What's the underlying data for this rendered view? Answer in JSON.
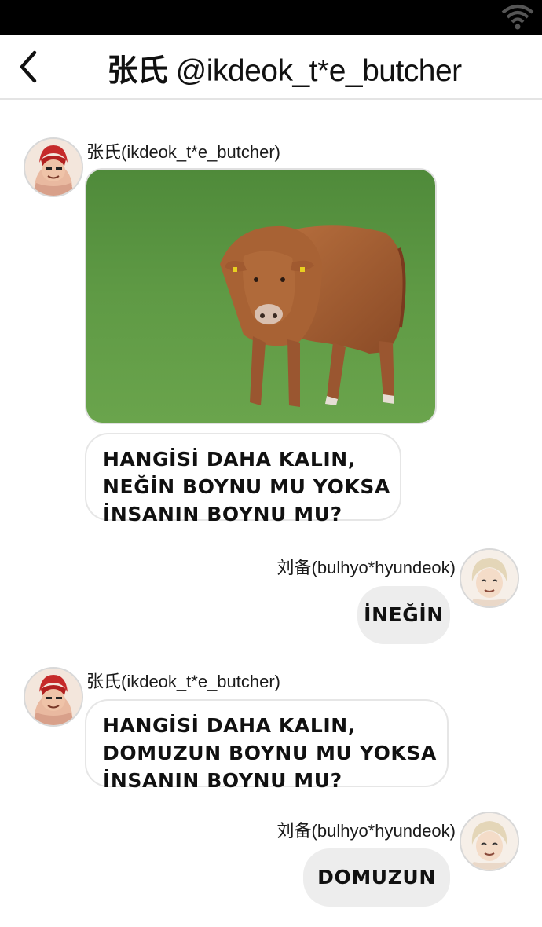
{
  "status_bar": {
    "wifi_icon": "wifi-icon"
  },
  "header": {
    "back_icon": "chevron-left-icon",
    "title_name": "张氏",
    "title_handle": "@ikdeok_t*e_butcher"
  },
  "messages": [
    {
      "sender": "张氏(ikdeok_t*e_butcher)",
      "side": "left",
      "image": "photo of a brown bull standing on green grass",
      "text": "HANGİSİ DAHA KALIN,\nNEĞİN BOYNU MU YOKSA\nİNSANIN BOYNU MU?"
    },
    {
      "sender": "刘备(bulhyo*hyundeok)",
      "side": "right",
      "text": "İNEĞİN"
    },
    {
      "sender": "张氏(ikdeok_t*e_butcher)",
      "side": "left",
      "text": "HANGİSİ DAHA KALIN,\nDOMUZUN BOYNU MU YOKSA\nİNSANIN BOYNU MU?"
    },
    {
      "sender": "刘备(bulhyo*hyundeok)",
      "side": "right",
      "text": "DOMUZUN"
    }
  ],
  "colors": {
    "status_bar": "#000000",
    "incoming_bubble": "#ffffff",
    "outgoing_bubble": "#ededed",
    "grass": "#5f9a45",
    "bull": "#a05a30"
  }
}
